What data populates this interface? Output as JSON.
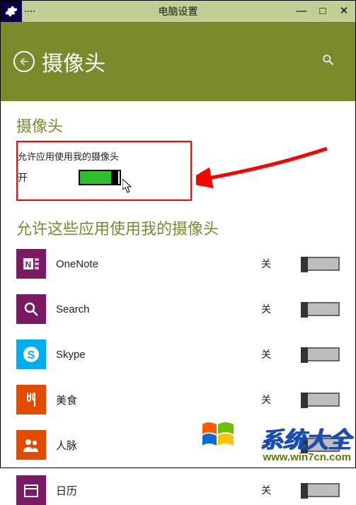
{
  "titlebar": {
    "title": "电脑设置",
    "minimize": "—",
    "maximize": "□",
    "close": "✕"
  },
  "header": {
    "title": "摄像头"
  },
  "main_toggle": {
    "section_label": "摄像头",
    "description": "允许应用使用我的摄像头",
    "state_text": "开",
    "on": true
  },
  "apps_section": {
    "title": "允许这些应用使用我的摄像头",
    "off_text": "关",
    "items": [
      {
        "name": "OneNote",
        "icon_bg": "#7b1a64",
        "state": "关",
        "on": false
      },
      {
        "name": "Search",
        "icon_bg": "#7b1a64",
        "state": "关",
        "on": false
      },
      {
        "name": "Skype",
        "icon_bg": "#00aff0",
        "state": "关",
        "on": false
      },
      {
        "name": "美食",
        "icon_bg": "#e24a00",
        "state": "关",
        "on": false
      },
      {
        "name": "人脉",
        "icon_bg": "#e24a00",
        "state": "关",
        "on": false
      },
      {
        "name": "日历",
        "icon_bg": "#7b1a64",
        "state": "关",
        "on": false
      }
    ]
  },
  "watermark": {
    "brand": "系统大全",
    "url": "www.win7cn.com"
  }
}
